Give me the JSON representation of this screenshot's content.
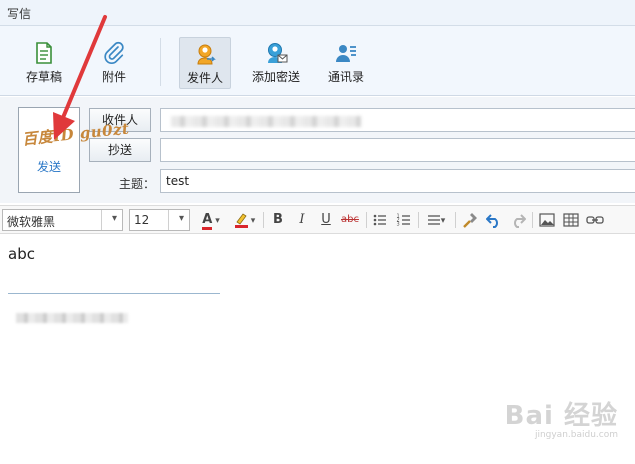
{
  "window": {
    "title": "写信"
  },
  "ribbon": {
    "draft": "存草稿",
    "attach": "附件",
    "sender": "发件人",
    "add_cc": "添加密送",
    "contacts": "通讯录"
  },
  "header": {
    "send_label": "发送",
    "watermark_text": "百度ID gu0zt",
    "to_label": "收件人",
    "cc_label": "抄送",
    "subject_label": "主题：",
    "subject_value": "test"
  },
  "format": {
    "font": "微软雅黑",
    "size": "12",
    "bold": "B",
    "italic": "I",
    "underline": "U",
    "strike": "abc",
    "font_color": "A"
  },
  "body": {
    "text": "abc"
  },
  "brand_watermark": {
    "main": "Bai 经验",
    "sub": "jingyan.baidu.com"
  },
  "colors": {
    "accent": "#2b78c7",
    "arrow": "#e0393b"
  }
}
